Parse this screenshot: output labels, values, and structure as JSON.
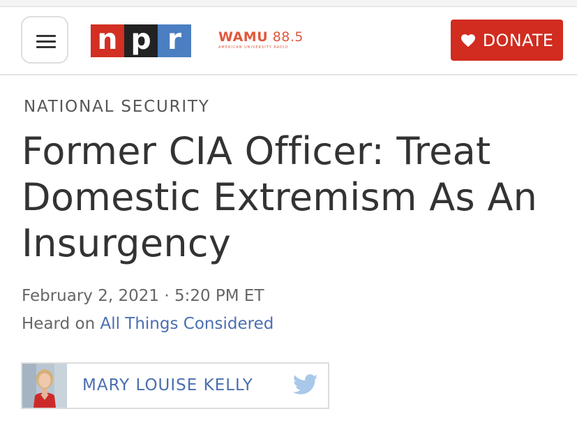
{
  "header": {
    "menu_button_label": "Menu",
    "npr_logo": {
      "letters": [
        "n",
        "p",
        "r"
      ],
      "colors": [
        "#d32f23",
        "#222222",
        "#4b7fc1"
      ]
    },
    "station": {
      "name": "WAMU",
      "frequency": "88.5",
      "subtitle": "AMERICAN UNIVERSITY RADIO",
      "color": "#e0593c"
    },
    "donate": {
      "label": "DONATE",
      "icon": "heart-icon",
      "color": "#d12c1f"
    }
  },
  "article": {
    "section": "NATIONAL SECURITY",
    "headline": "Former CIA Officer: Treat Domestic Extremism As An Insurgency",
    "dateline": "February 2, 2021 · 5:20 PM ET",
    "heard_on_prefix": "Heard on",
    "program": "All Things Considered",
    "link_color": "#4a6fb0"
  },
  "byline": {
    "author": "MARY LOUISE KELLY",
    "avatar_icon": "author-photo",
    "social_icon": "twitter-icon"
  }
}
